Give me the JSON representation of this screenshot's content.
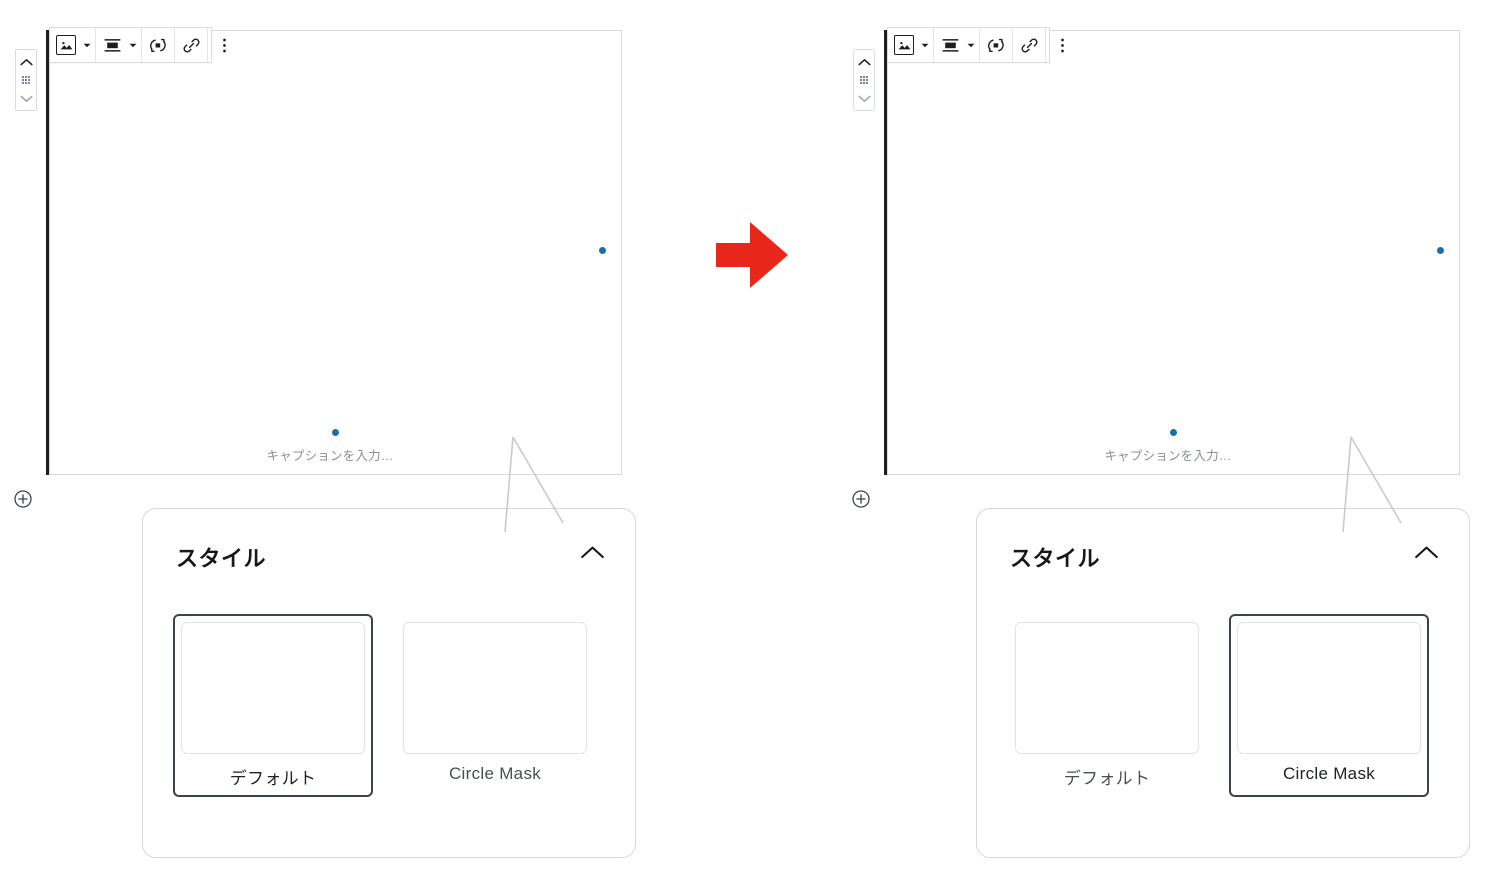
{
  "meta": {
    "app": "WordPress Block Editor",
    "language": "ja"
  },
  "colors": {
    "accent_handle": "#1a6fa8",
    "arrow_red": "#e8271b",
    "selected_border": "#3c434a",
    "panel_border": "#d5d7da",
    "toolbar_border": "#d9dcdf",
    "block_border": "#d7d9dc",
    "caption_text": "#8b8f94"
  },
  "toolbar": {
    "items": [
      {
        "icon": "image-block-icon",
        "label": "画像",
        "has_caret": true
      },
      {
        "icon": "align-center-icon",
        "label": "配置を変更",
        "has_caret": true
      },
      {
        "icon": "replace-image-icon",
        "label": "置換",
        "has_caret": false
      },
      {
        "icon": "link-icon",
        "label": "リンク",
        "has_caret": false
      },
      {
        "icon": "more-options-icon",
        "label": "オプション",
        "has_caret": false
      }
    ]
  },
  "mover": {
    "up_label": "上に移動",
    "drag_label": "ドラッグ",
    "down_label": "下に移動"
  },
  "add_block": {
    "label": "ブロックを追加"
  },
  "panels": [
    {
      "id": "before",
      "title": "スタイル",
      "collapse_icon": "chevron-up-icon",
      "caption_placeholder": "キャプションを入力…",
      "image_shape": "rectangle",
      "options": [
        {
          "label": "デフォルト",
          "thumb": "rectangle",
          "selected": true
        },
        {
          "label": "Circle Mask",
          "thumb": "circle",
          "selected": false
        }
      ]
    },
    {
      "id": "after",
      "title": "スタイル",
      "collapse_icon": "chevron-up-icon",
      "caption_placeholder": "キャプションを入力…",
      "image_shape": "circle",
      "options": [
        {
          "label": "デフォルト",
          "thumb": "rectangle",
          "selected": false
        },
        {
          "label": "Circle Mask",
          "thumb": "circle",
          "selected": true
        }
      ]
    }
  ],
  "transition_arrow": {
    "icon": "arrow-right-icon",
    "color": "#e8271b"
  }
}
